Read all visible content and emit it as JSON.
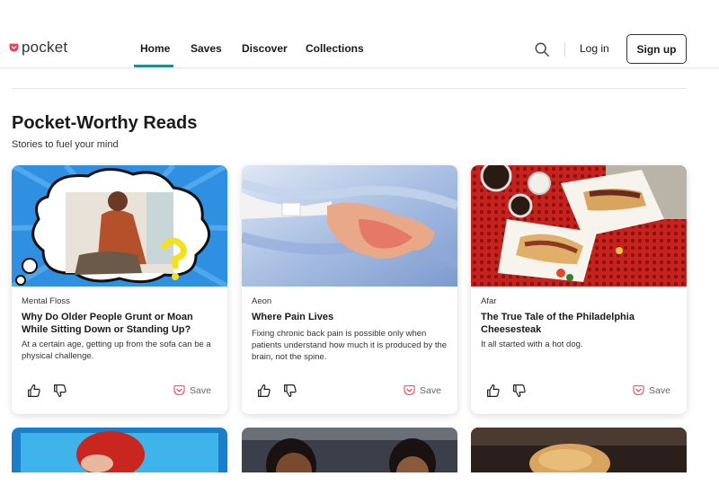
{
  "brand": {
    "name": "pocket",
    "accent": "#ef4056",
    "teal": "#1f8f8a"
  },
  "nav": {
    "items": [
      {
        "label": "Home",
        "active": true
      },
      {
        "label": "Saves"
      },
      {
        "label": "Discover"
      },
      {
        "label": "Collections"
      }
    ],
    "search_icon": "search-icon",
    "login_label": "Log in",
    "signup_label": "Sign up"
  },
  "section": {
    "title": "Pocket-Worthy Reads",
    "subtitle": "Stories to fuel your mind"
  },
  "cards": [
    {
      "publisher": "Mental Floss",
      "title": "Why Do Older People Grunt or Moan While Sitting Down or Standing Up?",
      "excerpt": "At a certain age, getting up from the sofa can be a physical challenge.",
      "save_label": "Save"
    },
    {
      "publisher": "Aeon",
      "title": "Where Pain Lives",
      "excerpt": "Fixing chronic back pain is possible only when patients understand how much it is produced by the brain, not the spine.",
      "save_label": "Save"
    },
    {
      "publisher": "Afar",
      "title": "The True Tale of the Philadelphia Cheesesteak",
      "excerpt": "It all started with a hot dog.",
      "save_label": "Save"
    }
  ],
  "icons": {
    "thumbs_up": "thumbs-up-icon",
    "thumbs_down": "thumbs-down-icon",
    "save": "pocket-save-icon"
  }
}
